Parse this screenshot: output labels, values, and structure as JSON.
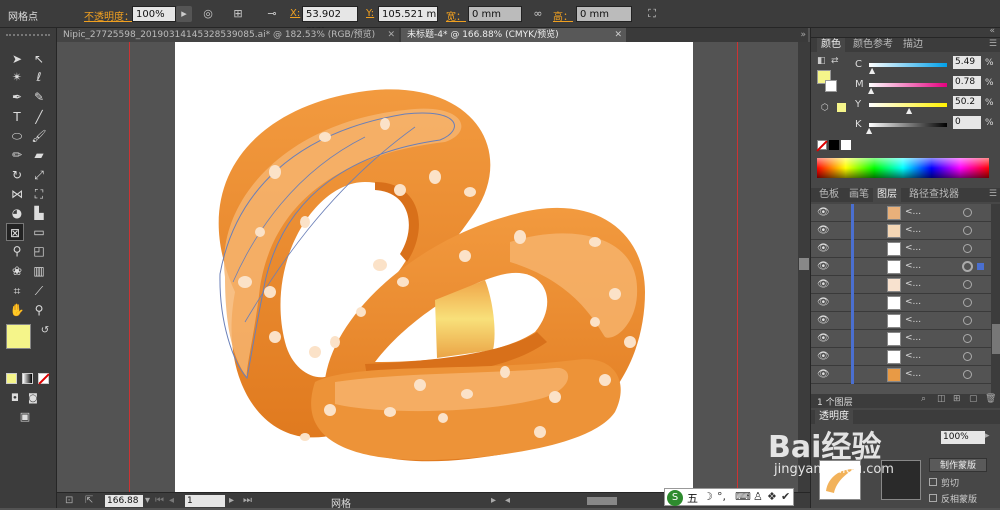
{
  "control_bar": {
    "mode_label": "网格点",
    "opacity_label": "不透明度：",
    "opacity_value": "100%",
    "x_label": "X:",
    "x_value": "53.902 mm",
    "y_label": "Y:",
    "y_value": "105.521 m",
    "width_label": "宽：",
    "width_value": "0 mm",
    "height_label": "高：",
    "height_value": "0 mm"
  },
  "tabs": [
    {
      "label": "Nipic_27725598_20190314145328539085.ai* @ 182.53% (RGB/预览)",
      "active": false
    },
    {
      "label": "未标题-4* @ 166.88% (CMYK/预览)",
      "active": true
    }
  ],
  "status": {
    "zoom": "166.88",
    "artboard": "1",
    "tool_name": "网格"
  },
  "panel": {
    "color_tabs": [
      "颜色",
      "颜色参考",
      "描边"
    ],
    "channels": [
      {
        "name": "C",
        "value": "5.49",
        "pct": 0.055,
        "gradient": "linear-gradient(90deg,#fff,#00a0e9)"
      },
      {
        "name": "M",
        "value": "0.78",
        "pct": 0.008,
        "gradient": "linear-gradient(90deg,#fff,#e4007f)"
      },
      {
        "name": "Y",
        "value": "50.2",
        "pct": 0.502,
        "gradient": "linear-gradient(90deg,#fff,#fff100)"
      },
      {
        "name": "K",
        "value": "0",
        "pct": 0.0,
        "gradient": "linear-gradient(90deg,#fff,#000)"
      }
    ],
    "fill_color": "#f5f58a",
    "layer_tabs": [
      "色板",
      "画笔",
      "图层",
      "路径查找器"
    ],
    "layer_rows": [
      {
        "label": "<...",
        "thumb": "#e8b07a"
      },
      {
        "label": "<...",
        "thumb": "#f5d7b5"
      },
      {
        "label": "<...",
        "thumb": "#ffffff"
      },
      {
        "label": "<...",
        "thumb": "#ffffff"
      },
      {
        "label": "<...",
        "thumb": "#f8e2cf"
      },
      {
        "label": "<...",
        "thumb": "#ffffff"
      },
      {
        "label": "<...",
        "thumb": "#ffffff"
      },
      {
        "label": "<...",
        "thumb": "#ffffff"
      },
      {
        "label": "<...",
        "thumb": "#ffffff"
      },
      {
        "label": "<...",
        "thumb": "#e89a45"
      },
      {
        "label": "<...",
        "thumb": "#f0b878"
      },
      {
        "label": "<...",
        "thumb": "#f3c48d"
      }
    ],
    "layers_count": "1 个图层",
    "transparency_tab": "透明度",
    "transparency_value": "100%",
    "mask_button": "制作蒙版",
    "clip_label": "剪切",
    "invert_label": "反相蒙版"
  },
  "watermark": {
    "brand": "Bai经验",
    "url": "jingyan.baidu.com"
  },
  "ime": {
    "label": "五"
  }
}
